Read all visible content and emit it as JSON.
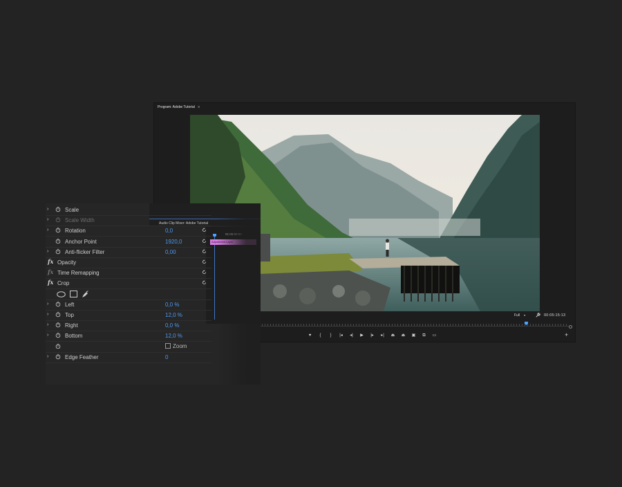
{
  "program_monitor": {
    "tab_title": "Program: Adobe Tutorial",
    "tab_menu": "≡",
    "fit": "Full",
    "timecode": "00:05:15:13",
    "add_button": "+"
  },
  "transport": {
    "buttons": [
      {
        "name": "add-marker-button",
        "icon": "marker-icon",
        "glyph": "♥"
      },
      {
        "name": "mark-in-button",
        "icon": "mark-in-icon",
        "glyph": "{"
      },
      {
        "name": "mark-out-button",
        "icon": "mark-out-icon",
        "glyph": "}"
      },
      {
        "name": "go-to-in-button",
        "icon": "go-to-in-icon",
        "glyph": "|◂"
      },
      {
        "name": "step-back-button",
        "icon": "step-back-icon",
        "glyph": "◂|"
      },
      {
        "name": "play-button",
        "icon": "play-icon",
        "glyph": "▶"
      },
      {
        "name": "step-forward-button",
        "icon": "step-forward-icon",
        "glyph": "|▸"
      },
      {
        "name": "go-to-out-button",
        "icon": "go-to-out-icon",
        "glyph": "▸|"
      },
      {
        "name": "lift-button",
        "icon": "lift-icon",
        "glyph": "⏏"
      },
      {
        "name": "extract-button",
        "icon": "extract-icon",
        "glyph": "⏏"
      },
      {
        "name": "export-frame-button",
        "icon": "camera-icon",
        "glyph": "▣"
      },
      {
        "name": "comparison-view-button",
        "icon": "comparison-icon",
        "glyph": "⧉"
      },
      {
        "name": "settings-button",
        "icon": "settings-icon",
        "glyph": "▭"
      }
    ]
  },
  "audio_mixer": {
    "title": "Audio Clip Mixer: Adobe Tutorial"
  },
  "timeline": {
    "timecode": "01:05:00:00",
    "clip_label": "Adjustment Layer"
  },
  "effect_controls": {
    "rows": [
      {
        "type": "prop",
        "label": "Scale",
        "value": "",
        "dim": false,
        "chevron": true,
        "reset": false
      },
      {
        "type": "prop",
        "label": "Scale Width",
        "value": "",
        "dim": true,
        "chevron": true,
        "reset": false
      },
      {
        "type": "prop",
        "label": "Rotation",
        "value": "0,0",
        "dim": false,
        "chevron": true,
        "reset": true
      },
      {
        "type": "prop",
        "label": "Anchor Point",
        "value": "1920,0",
        "dim": false,
        "chevron": false,
        "reset": true
      },
      {
        "type": "prop",
        "label": "Anti-flicker Filter",
        "value": "0,00",
        "dim": false,
        "chevron": true,
        "reset": true
      },
      {
        "type": "fx",
        "label": "Opacity",
        "value": "",
        "dim": false,
        "chevron": false,
        "reset": true
      },
      {
        "type": "fx",
        "label": "Time Remapping",
        "value": "",
        "dim": false,
        "chevron": false,
        "reset": true
      },
      {
        "type": "fx",
        "label": "Crop",
        "value": "",
        "dim": false,
        "chevron": false,
        "reset": true
      },
      {
        "type": "tools",
        "label": "",
        "value": "",
        "dim": false,
        "chevron": false,
        "reset": false
      },
      {
        "type": "prop",
        "label": "Left",
        "value": "0,0 %",
        "dim": false,
        "chevron": true,
        "reset": false
      },
      {
        "type": "prop",
        "label": "Top",
        "value": "12,0 %",
        "dim": false,
        "chevron": true,
        "reset": false
      },
      {
        "type": "prop",
        "label": "Right",
        "value": "0,0 %",
        "dim": false,
        "chevron": true,
        "reset": false
      },
      {
        "type": "prop",
        "label": "Bottom",
        "value": "12,0 %",
        "dim": false,
        "chevron": true,
        "reset": false
      },
      {
        "type": "zoom",
        "label": "",
        "value": "",
        "dim": false,
        "chevron": false,
        "reset": false
      },
      {
        "type": "prop",
        "label": "Edge Feather",
        "value": "0",
        "dim": false,
        "chevron": true,
        "reset": false
      }
    ],
    "zoom_label": "Zoom"
  },
  "colors": {
    "background": "#232323",
    "panel": "#262626",
    "value_blue": "#4d9bf0",
    "clip_pink": "#d77ce0",
    "playhead_blue": "#4aa3ff"
  }
}
